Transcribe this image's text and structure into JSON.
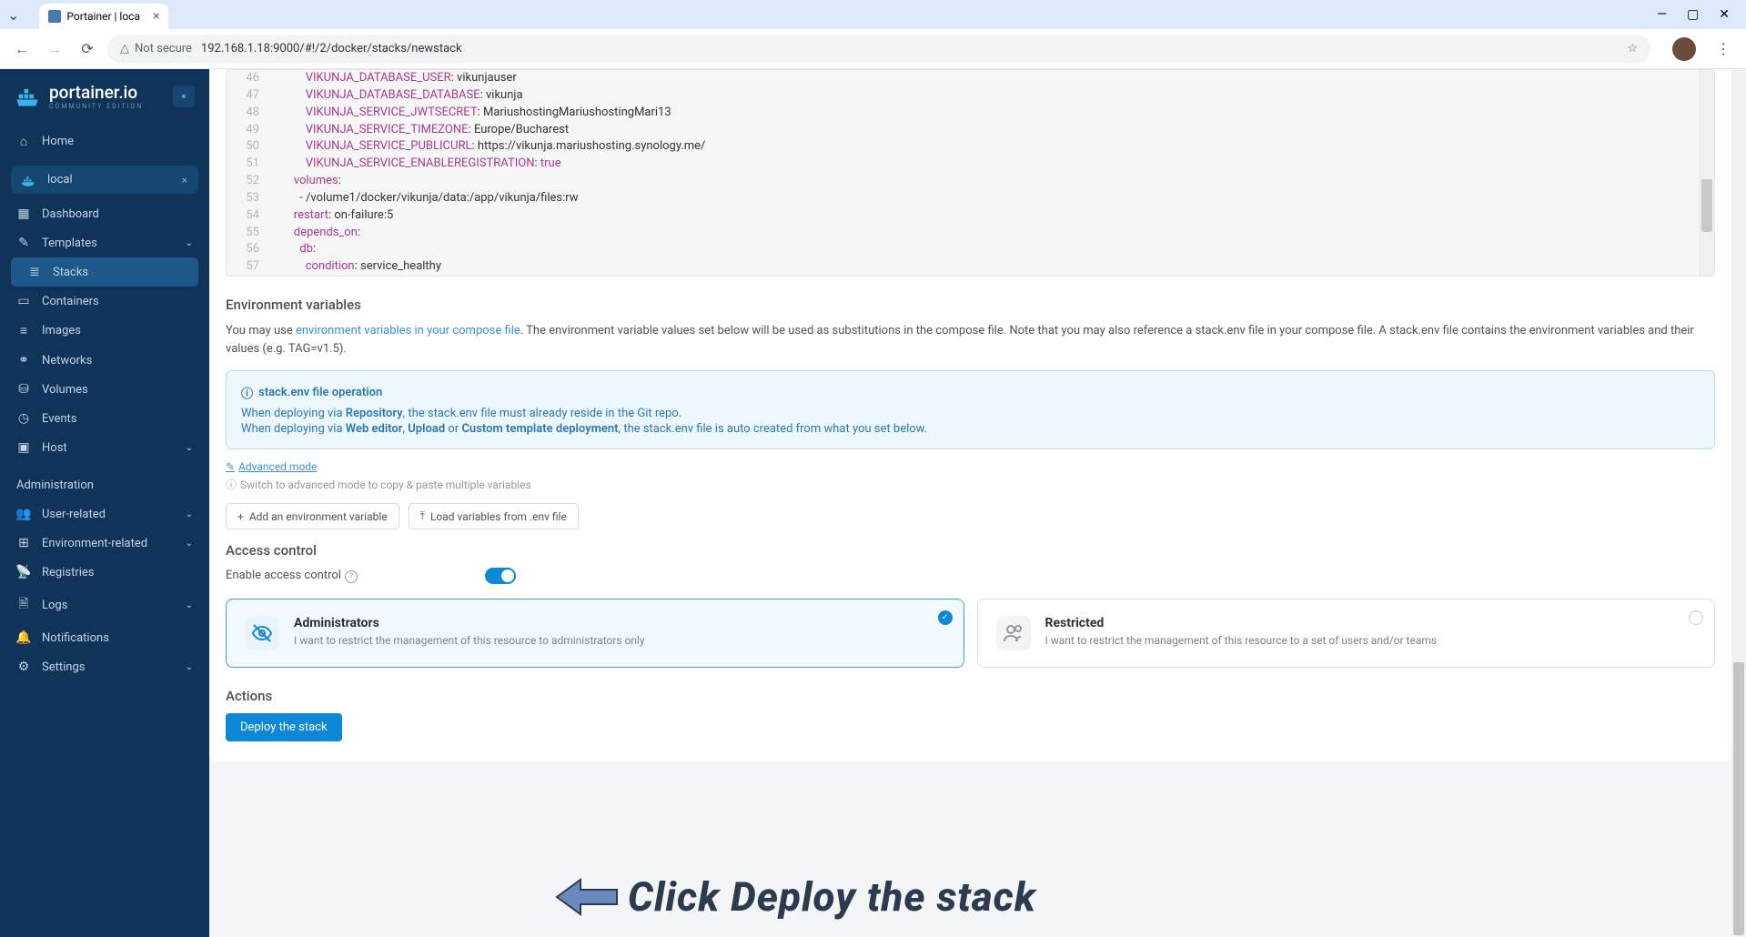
{
  "browser": {
    "tab_title": "Portainer | loca",
    "not_secure": "Not secure",
    "url": "192.168.1.18:9000/#!/2/docker/stacks/newstack"
  },
  "sidebar": {
    "logo_title": "portainer.io",
    "logo_sub": "COMMUNITY EDITION",
    "home": "Home",
    "env_name": "local",
    "items": [
      "Dashboard",
      "Templates",
      "Stacks",
      "Containers",
      "Images",
      "Networks",
      "Volumes",
      "Events",
      "Host"
    ],
    "admin_section": "Administration",
    "admin_items": [
      "User-related",
      "Environment-related",
      "Registries",
      "Logs",
      "Notifications",
      "Settings"
    ]
  },
  "editor": {
    "lines": [
      {
        "n": 46,
        "indent": 12,
        "key": "VIKUNJA_DATABASE_USER",
        "val": "vikunjauser"
      },
      {
        "n": 47,
        "indent": 12,
        "key": "VIKUNJA_DATABASE_DATABASE",
        "val": "vikunja"
      },
      {
        "n": 48,
        "indent": 12,
        "key": "VIKUNJA_SERVICE_JWTSECRET",
        "val": "MariushostingMariushostingMari13"
      },
      {
        "n": 49,
        "indent": 12,
        "key": "VIKUNJA_SERVICE_TIMEZONE",
        "val": "Europe/Bucharest"
      },
      {
        "n": 50,
        "indent": 12,
        "key": "VIKUNJA_SERVICE_PUBLICURL",
        "val": "https://vikunja.mariushosting.synology.me/"
      },
      {
        "n": 51,
        "indent": 12,
        "key": "VIKUNJA_SERVICE_ENABLEREGISTRATION",
        "val": "true",
        "bool": true
      },
      {
        "n": 52,
        "indent": 8,
        "key": "volumes",
        "val": ""
      },
      {
        "n": 53,
        "indent": 10,
        "plain": "- /volume1/docker/vikunja/data:/app/vikunja/files:rw"
      },
      {
        "n": 54,
        "indent": 8,
        "key": "restart",
        "val": "on-failure:5"
      },
      {
        "n": 55,
        "indent": 8,
        "key": "depends_on",
        "val": ""
      },
      {
        "n": 56,
        "indent": 10,
        "key": "db",
        "val": ""
      },
      {
        "n": 57,
        "indent": 12,
        "key": "condition",
        "val": "service_healthy"
      }
    ]
  },
  "env": {
    "heading": "Environment variables",
    "help_pre": "You may use ",
    "help_link": "environment variables in your compose file",
    "help_post": ". The environment variable values set below will be used as substitutions in the compose file. Note that you may also reference a stack.env file in your compose file. A stack.env file contains the environment variables and their values (e.g. TAG=v1.5).",
    "info_title": "stack.env file operation",
    "info_l1a": "When deploying via ",
    "info_l1b": "Repository",
    "info_l1c": ", the stack.env file must already reside in the Git repo.",
    "info_l2a": "When deploying via ",
    "info_l2b": "Web editor",
    "info_l2c": ", ",
    "info_l2d": "Upload",
    "info_l2e": " or ",
    "info_l2f": "Custom template deployment",
    "info_l2g": ", the stack.env file is auto created from what you set below.",
    "advanced": "Advanced mode",
    "advanced_help": "Switch to advanced mode to copy & paste multiple variables",
    "add_btn": "Add an environment variable",
    "load_btn": "Load variables from .env file"
  },
  "access": {
    "heading": "Access control",
    "enable_label": "Enable access control",
    "admin_title": "Administrators",
    "admin_desc": "I want to restrict the management of this resource to administrators only",
    "restricted_title": "Restricted",
    "restricted_desc": "I want to restrict the management of this resource to a set of users and/or teams"
  },
  "actions": {
    "heading": "Actions",
    "deploy": "Deploy the stack"
  },
  "annotation": {
    "text": "Click Deploy the stack"
  }
}
